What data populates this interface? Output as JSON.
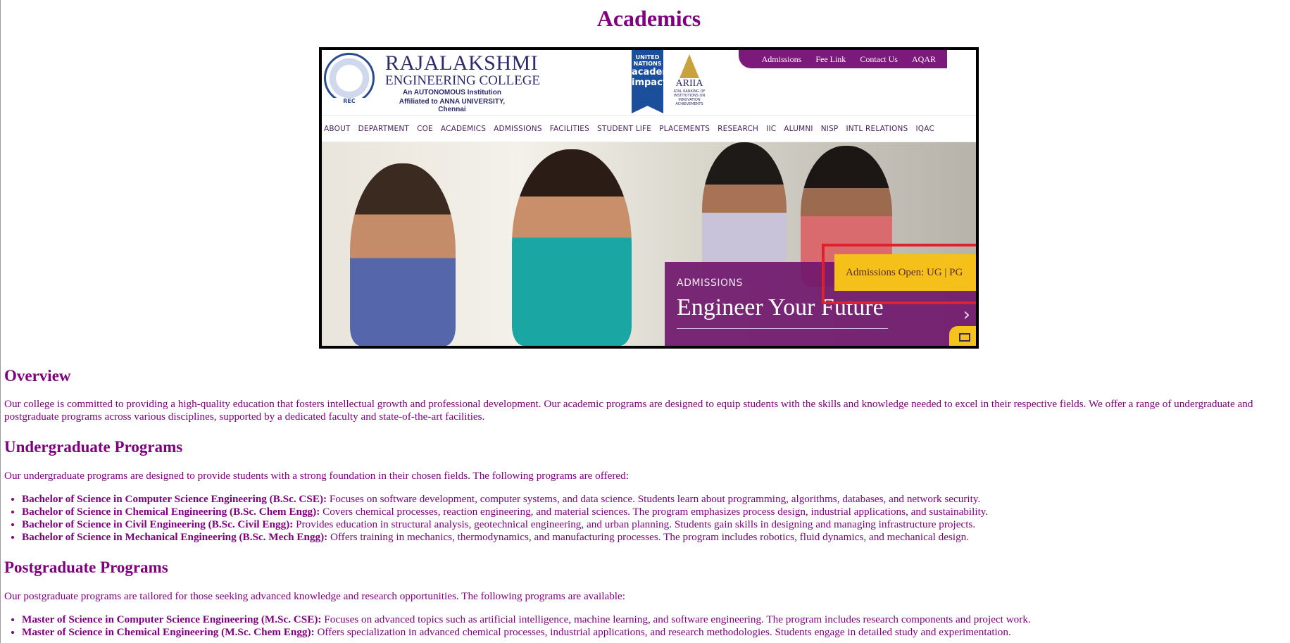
{
  "page": {
    "title": "Academics",
    "colors": {
      "text": "#800080",
      "banner_purple": "#7b1a7a",
      "admissions_yellow": "#f5c01a",
      "highlight_red": "#e0202a"
    }
  },
  "banner": {
    "college_name": "RAJALAKSHMI",
    "college_sub": "ENGINEERING COLLEGE",
    "college_auto": "An AUTONOMOUS Institution",
    "college_aff": "Affiliated to ANNA UNIVERSITY, Chennai",
    "seal_text": "REC",
    "un_badge_top": "UNITED NATIONS",
    "un_badge_main": "academic impact",
    "ariia_label": "ARIIA",
    "ariia_small": "ATAL RANKING OF INSTITUTIONS ON INNOVATION ACHIEVEMENTS",
    "top_links": [
      "Admissions",
      "Fee Link",
      "Contact Us",
      "AQAR"
    ],
    "nav_items": [
      "ABOUT",
      "DEPARTMENT",
      "COE",
      "ACADEMICS",
      "ADMISSIONS",
      "FACILITIES",
      "STUDENT LIFE",
      "PLACEMENTS",
      "RESEARCH",
      "IIC",
      "ALUMNI",
      "NISP",
      "INTL RELATIONS",
      "IQAC"
    ],
    "admissions_kicker": "ADMISSIONS",
    "admissions_title": "Engineer Your Future",
    "admissions_open": "Admissions Open: UG | PG"
  },
  "overview": {
    "heading": "Overview",
    "text": "Our college is committed to providing a high-quality education that fosters intellectual growth and professional development. Our academic programs are designed to equip students with the skills and knowledge needed to excel in their respective fields. We offer a range of undergraduate and postgraduate programs across various disciplines, supported by a dedicated faculty and state-of-the-art facilities."
  },
  "undergraduate": {
    "heading": "Undergraduate Programs",
    "intro": "Our undergraduate programs are designed to provide students with a strong foundation in their chosen fields. The following programs are offered:",
    "items": [
      {
        "name": "Bachelor of Science in Computer Science Engineering (B.Sc. CSE):",
        "desc": " Focuses on software development, computer systems, and data science. Students learn about programming, algorithms, databases, and network security."
      },
      {
        "name": "Bachelor of Science in Chemical Engineering (B.Sc. Chem Engg):",
        "desc": " Covers chemical processes, reaction engineering, and material sciences. The program emphasizes process design, industrial applications, and sustainability."
      },
      {
        "name": "Bachelor of Science in Civil Engineering (B.Sc. Civil Engg):",
        "desc": " Provides education in structural analysis, geotechnical engineering, and urban planning. Students gain skills in designing and managing infrastructure projects."
      },
      {
        "name": "Bachelor of Science in Mechanical Engineering (B.Sc. Mech Engg):",
        "desc": " Offers training in mechanics, thermodynamics, and manufacturing processes. The program includes robotics, fluid dynamics, and mechanical design."
      }
    ]
  },
  "postgraduate": {
    "heading": "Postgraduate Programs",
    "intro": "Our postgraduate programs are tailored for those seeking advanced knowledge and research opportunities. The following programs are available:",
    "items": [
      {
        "name": "Master of Science in Computer Science Engineering (M.Sc. CSE):",
        "desc": " Focuses on advanced topics such as artificial intelligence, machine learning, and software engineering. The program includes research components and project work."
      },
      {
        "name": "Master of Science in Chemical Engineering (M.Sc. Chem Engg):",
        "desc": " Offers specialization in advanced chemical processes, industrial applications, and research methodologies. Students engage in detailed study and experimentation."
      }
    ]
  }
}
